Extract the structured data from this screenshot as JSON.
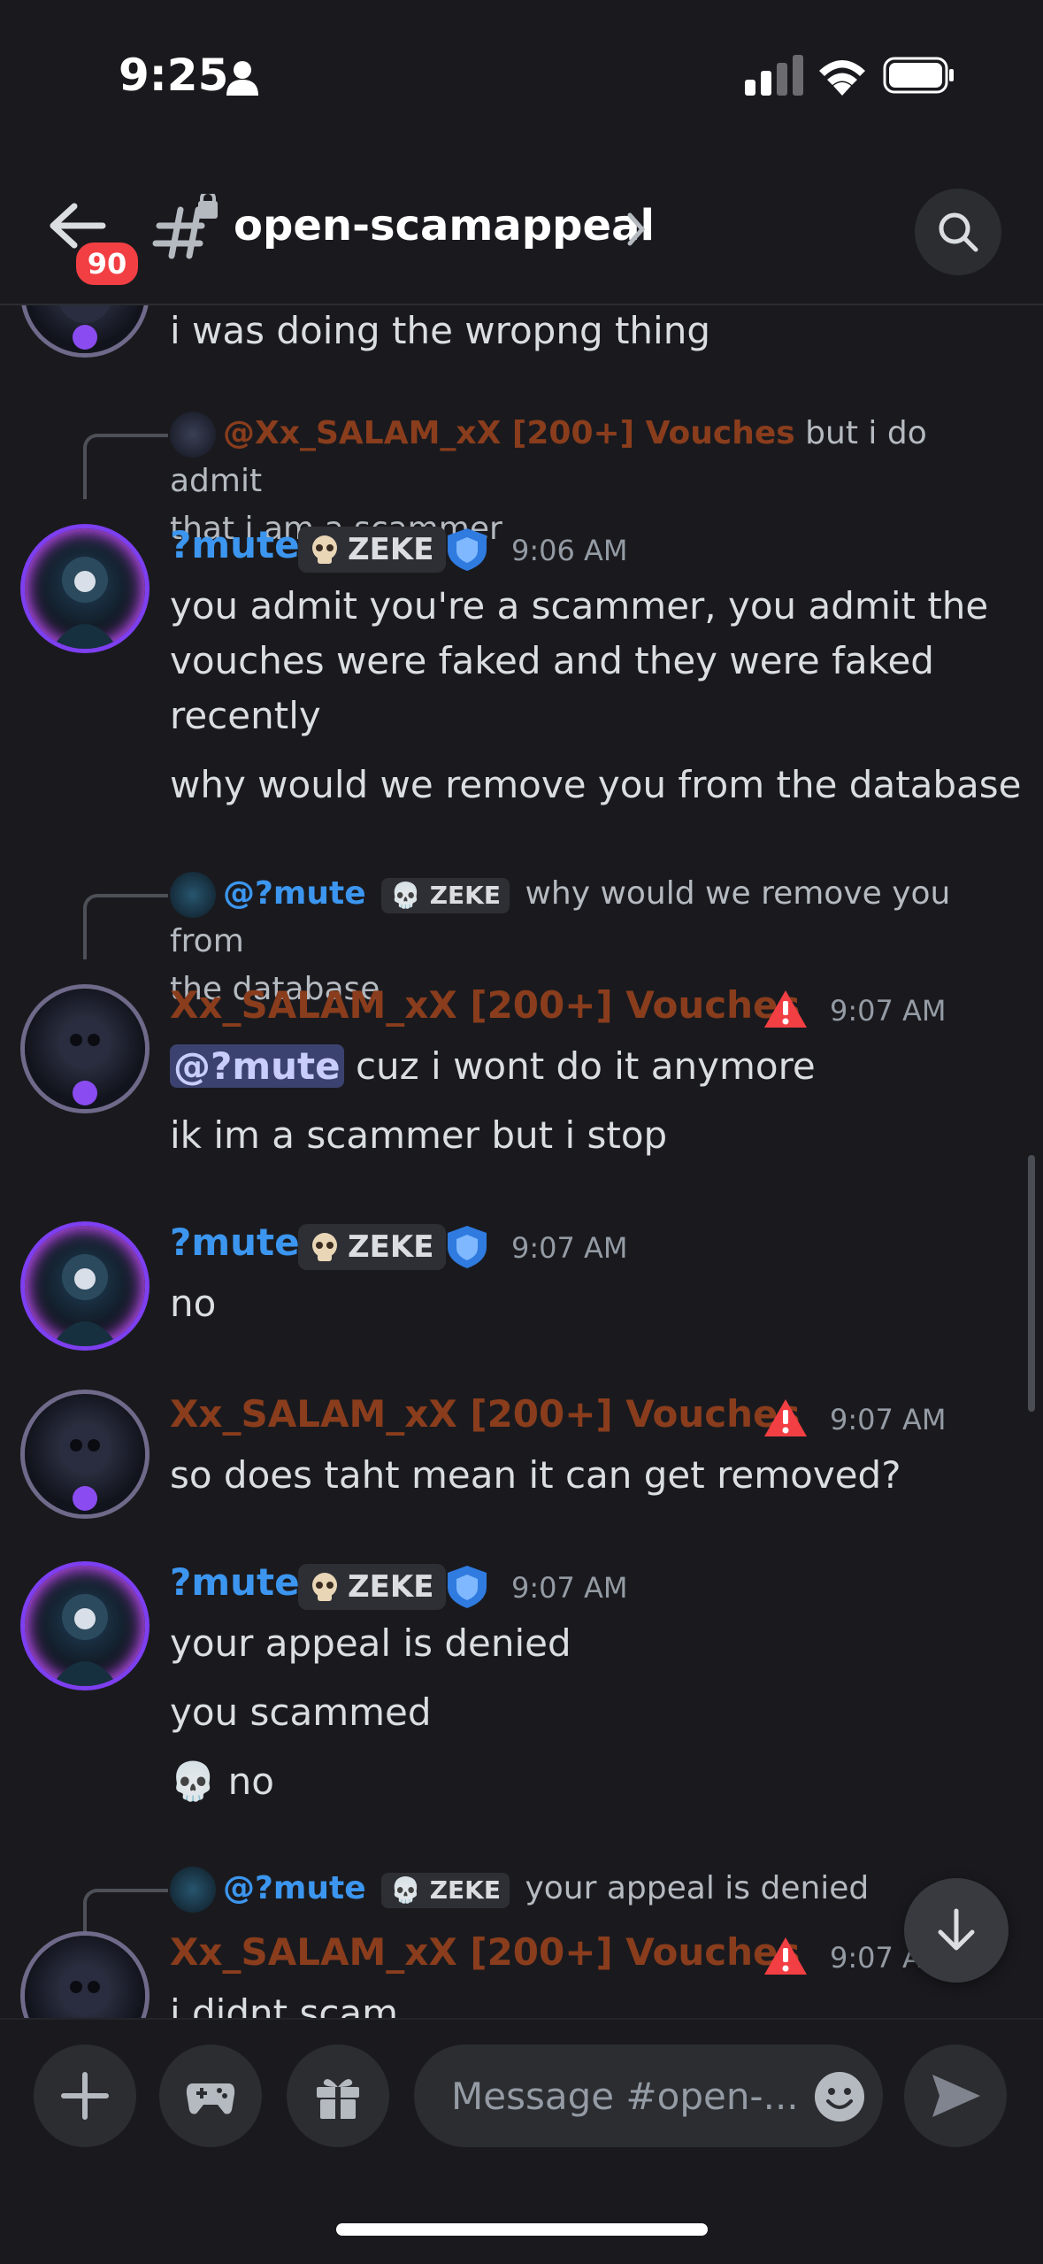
{
  "status": {
    "time": "9:25"
  },
  "header": {
    "back_badge": "90",
    "channel": "open-scamappeal"
  },
  "messages": {
    "m0_text": "i was doing the wropng thing",
    "r1_name": "@Xx_SALAM_xX [200+] Vouches",
    "r1_l1": "but i do admit",
    "r1_l2": "that i am a scammer",
    "m1_user": "?mute",
    "tag": "ZEKE",
    "m1_time": "9:06 AM",
    "m1_l1": "you admit you're a scammer, you admit the",
    "m1_l2": "vouches were faked and they were faked",
    "m1_l3": "recently",
    "m1_l4": "why would we remove you from the database",
    "r2_name": "@?mute",
    "r2_l1": "why would we remove you from",
    "r2_l2": "the database",
    "m2_user": "Xx_SALAM_xX [200+] Vouches",
    "m2_time": "9:07 AM",
    "m2_mention": "@?mute",
    "m2_l1": " cuz i wont do it anymore",
    "m2_l2": "ik im a scammer but i stop",
    "m3_user": "?mute",
    "m3_time": "9:07 AM",
    "m3_l1": "no",
    "m4_user": "Xx_SALAM_xX [200+] Vouches",
    "m4_time": "9:07 AM",
    "m4_l1": "so does taht mean it can get removed?",
    "m5_user": "?mute",
    "m5_time": "9:07 AM",
    "m5_l1": "your appeal is denied",
    "m5_l2": "you scammed",
    "m5_l3_emoji": "💀",
    "m5_l3": "no",
    "r6_name": "@?mute",
    "r6_text": "your appeal is denied",
    "m6_user": "Xx_SALAM_xX [200+] Vouches",
    "m6_time": "9:07 AM",
    "m6_l1": "i didnt scam"
  },
  "composer": {
    "placeholder": "Message #open-..."
  },
  "colors": {
    "username_blue": "#3c96ef",
    "username_orange": "#8a3d1c",
    "badge_red": "#f23f43"
  }
}
